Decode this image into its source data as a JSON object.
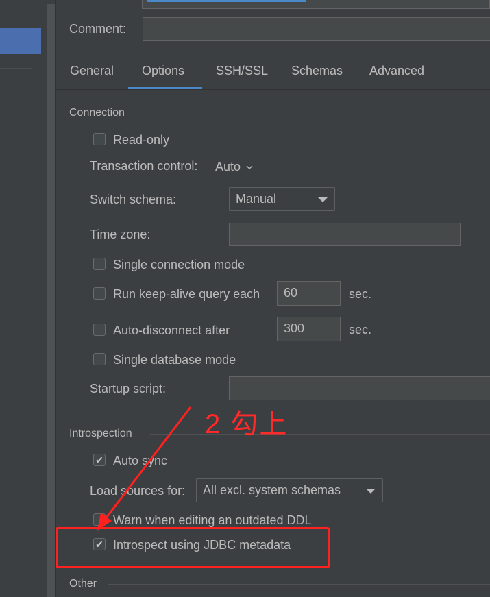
{
  "comment": {
    "label": "Comment:",
    "value": ""
  },
  "tabs": [
    {
      "label": "General"
    },
    {
      "label": "Options"
    },
    {
      "label": "SSH/SSL"
    },
    {
      "label": "Schemas"
    },
    {
      "label": "Advanced"
    }
  ],
  "active_tab": "Options",
  "connection": {
    "title": "Connection",
    "read_only": {
      "label": "Read-only",
      "checked": false
    },
    "transaction_control": {
      "label": "Transaction control:",
      "value": "Auto"
    },
    "switch_schema": {
      "label": "Switch schema:",
      "value": "Manual"
    },
    "time_zone": {
      "label": "Time zone:",
      "value": ""
    },
    "single_connection": {
      "label": "Single connection mode",
      "checked": false
    },
    "keep_alive": {
      "label": "Run keep-alive query each",
      "value": "60",
      "unit": "sec.",
      "checked": false
    },
    "auto_disconnect": {
      "label": "Auto-disconnect after",
      "value": "300",
      "unit": "sec.",
      "checked": false
    },
    "single_database": {
      "label_first": "S",
      "label_rest": "ingle database mode",
      "checked": false
    },
    "startup_script": {
      "label": "Startup script:",
      "value": ""
    }
  },
  "introspection": {
    "title": "Introspection",
    "auto_sync": {
      "label": "Auto sync",
      "checked": true
    },
    "load_sources": {
      "label": "Load sources for:",
      "value": "All excl. system schemas"
    },
    "warn_outdated": {
      "label": "Warn when editing an outdated DDL",
      "checked": false
    },
    "jdbc_metadata": {
      "label_pre": "Introspect using JDBC ",
      "label_u": "m",
      "label_post": "etadata",
      "checked": true
    }
  },
  "other": {
    "title": "Other"
  },
  "annotation": {
    "text": "2 勾上",
    "color": "#ff2a2a"
  },
  "colors": {
    "accent": "#4a88c7",
    "background": "#3c3f41",
    "annotation_red": "#ff2020"
  }
}
